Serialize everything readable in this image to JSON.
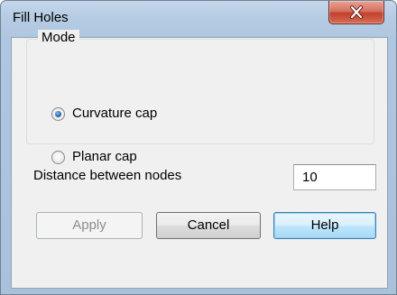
{
  "window": {
    "title": "Fill Holes",
    "close_icon": "close-x-icon"
  },
  "mode_group": {
    "title": "Mode",
    "options": [
      {
        "label": "Curvature cap",
        "selected": true
      },
      {
        "label": "Planar cap",
        "selected": false
      }
    ]
  },
  "distance": {
    "label": "Distance between nodes",
    "value": "10"
  },
  "buttons": {
    "apply": "Apply",
    "cancel": "Cancel",
    "help": "Help"
  },
  "colors": {
    "title_bar": "#b9cfe6",
    "close_button": "#c9503c",
    "client_bg": "#f0f0f0",
    "radio_dot": "#2a6bb3"
  }
}
